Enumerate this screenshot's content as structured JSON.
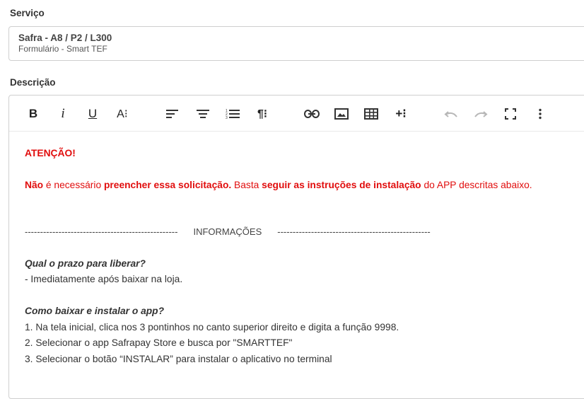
{
  "service": {
    "label": "Serviço",
    "title": "Safra - A8 / P2 / L300",
    "subtitle": "Formulário - Smart TEF"
  },
  "description": {
    "label": "Descrição"
  },
  "toolbar": {
    "bold": "B",
    "italic": "i",
    "underline": "U",
    "font_size": "A⁝",
    "paragraph_format": "¶⁝",
    "insert_more": "+⁝"
  },
  "content": {
    "attention": "ATENÇÃO!",
    "notice": {
      "p1": "Não",
      "p2": " é necessário ",
      "p3": "preencher essa solicitação.",
      "p4": " Basta ",
      "p5": "seguir as instruções de instalação",
      "p6": " do APP descritas abaixo."
    },
    "divider_left": "--------------------------------------------------",
    "divider_title": "INFORMAÇÕES",
    "divider_right": "--------------------------------------------------",
    "q1": "Qual o prazo para liberar?",
    "a1": "- Imediatamente após baixar na loja.",
    "q2": "Como baixar e instalar o app?",
    "steps": [
      "1. Na tela inicial, clica nos 3 pontinhos no canto superior direito e digita a função 9998.",
      "2. Selecionar o app Safrapay Store e busca por \"SMARTTEF\"",
      "3. Selecionar o botão “INSTALAR” para instalar o aplicativo no terminal"
    ]
  },
  "colors": {
    "accent_red": "#e10d0d",
    "border": "#cfcfcf"
  }
}
